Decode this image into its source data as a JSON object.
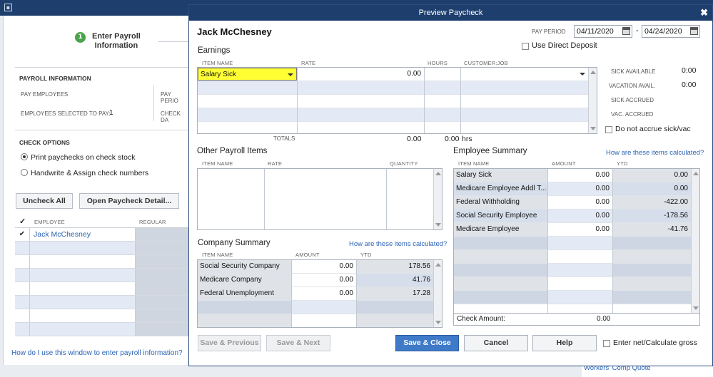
{
  "background": {
    "step_number": "1",
    "step_label_1": "Enter Payroll",
    "step_label_2": "Information",
    "payroll_info_heading": "PAYROLL INFORMATION",
    "pay_employees": "PAY EMPLOYEES",
    "pay_period_cut": "PAY PERIO",
    "employees_selected_label": "EMPLOYEES SELECTED TO PAY:",
    "employees_selected_value": "1",
    "check_date_cut": "CHECK DA",
    "check_options_heading": "CHECK OPTIONS",
    "print_option": "Print paychecks on check stock",
    "handwrite_option": "Handwrite & Assign check numbers",
    "uncheck_all": "Uncheck All",
    "open_paycheck_detail": "Open Paycheck Detail...",
    "grid_check_header": "✓",
    "grid_employee_header": "EMPLOYEE",
    "grid_regular_header": "REGULAR",
    "employee_row": "Jack McChesney",
    "help_link": "How do I use this window to enter payroll information?",
    "footer_link": "Workers' Comp Quote"
  },
  "dialog": {
    "title": "Preview Paycheck",
    "close_glyph": "✖",
    "employee_name": "Jack McChesney",
    "pay_period_label": "PAY PERIOD",
    "pay_period_from": "04/11/2020",
    "pay_period_dash": "-",
    "pay_period_to": "04/24/2020",
    "use_direct_deposit": "Use Direct Deposit",
    "earnings": {
      "heading": "Earnings",
      "headers": [
        "ITEM NAME",
        "RATE",
        "HOURS",
        "CUSTOMER:JOB"
      ],
      "row_item": "Salary Sick",
      "row_rate": "0.00",
      "totals_label": "TOTALS",
      "total_rate": "0.00",
      "total_hours": "0:00",
      "hrs_unit": "hrs"
    },
    "leave": {
      "sick_available_label": "SICK AVAILABLE",
      "sick_available": "0:00",
      "vacation_avail_label": "VACATION AVAIL.",
      "vacation_avail": "0:00",
      "sick_accrued_label": "SICK ACCRUED",
      "vac_accrued_label": "VAC. ACCRUED",
      "do_not_accrue": "Do not accrue sick/vac"
    },
    "other_payroll": {
      "heading": "Other Payroll Items",
      "headers": [
        "ITEM NAME",
        "RATE",
        "QUANTITY"
      ]
    },
    "employee_summary": {
      "heading": "Employee Summary",
      "how_link": "How are these items calculated?",
      "headers": [
        "ITEM NAME",
        "AMOUNT",
        "YTD"
      ],
      "rows": [
        {
          "name": "Salary Sick",
          "amount": "0.00",
          "ytd": "0.00"
        },
        {
          "name": "Medicare Employee Addl T...",
          "amount": "0.00",
          "ytd": "0.00"
        },
        {
          "name": "Federal Withholding",
          "amount": "0.00",
          "ytd": "-422.00"
        },
        {
          "name": "Social Security Employee",
          "amount": "0.00",
          "ytd": "-178.56"
        },
        {
          "name": "Medicare Employee",
          "amount": "0.00",
          "ytd": "-41.76"
        }
      ],
      "check_amount_label": "Check Amount:",
      "check_amount": "0.00"
    },
    "company_summary": {
      "heading": "Company Summary",
      "how_link": "How are these items calculated?",
      "headers": [
        "ITEM NAME",
        "AMOUNT",
        "YTD"
      ],
      "rows": [
        {
          "name": "Social Security Company",
          "amount": "0.00",
          "ytd": "178.56"
        },
        {
          "name": "Medicare Company",
          "amount": "0.00",
          "ytd": "41.76"
        },
        {
          "name": "Federal Unemployment",
          "amount": "0.00",
          "ytd": "17.28"
        }
      ]
    },
    "buttons": {
      "save_previous": "Save & Previous",
      "save_next": "Save & Next",
      "save_close": "Save & Close",
      "cancel": "Cancel",
      "help": "Help",
      "enter_net": "Enter net/Calculate gross"
    }
  },
  "colors": {
    "title_bar": "#1e3f6e",
    "highlight": "#ffff33",
    "link": "#2a63b5",
    "primary_button": "#3f7ac9",
    "step_badge": "#4aa34a"
  }
}
